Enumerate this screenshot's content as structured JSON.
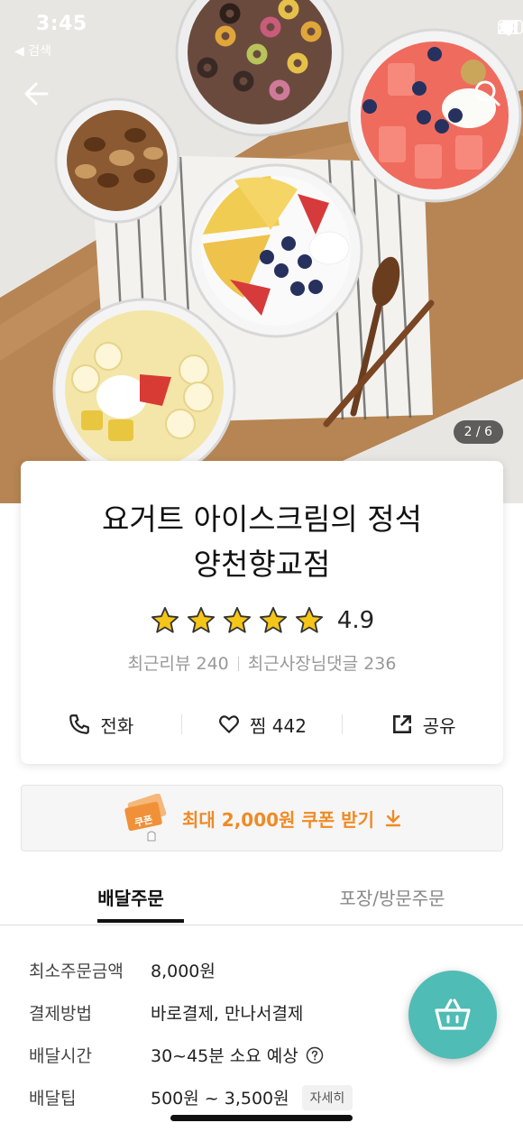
{
  "status_bar": {
    "time": "3:45",
    "back_label": "◀ 검색"
  },
  "hero": {
    "photo_counter": "2 / 6"
  },
  "store": {
    "name_line1": "요거트 아이스크림의 정석",
    "name_line2": "양천향교점",
    "rating": "4.9",
    "stars": 5,
    "recent_reviews": "최근리뷰 240",
    "owner_replies": "최근사장님댓글 236"
  },
  "actions": {
    "call_label": "전화",
    "favorite_label": "찜 442",
    "share_label": "공유"
  },
  "coupon": {
    "label": "최대 2,000원 쿠폰 받기",
    "tag_text": "쿠폰"
  },
  "tabs": [
    {
      "label": "배달주문",
      "active": true
    },
    {
      "label": "포장/방문주문",
      "active": false
    }
  ],
  "details": [
    {
      "label": "최소주문금액",
      "value": "8,000원"
    },
    {
      "label": "결제방법",
      "value": "바로결제, 만나서결제"
    },
    {
      "label": "배달시간",
      "value": "30~45분 소요 예상"
    },
    {
      "label": "배달팁",
      "value": "500원 ~ 3,500원",
      "chip": "자세히"
    }
  ],
  "colors": {
    "accent_orange": "#f08a24",
    "fab_teal": "#4fbcb5",
    "star_yellow": "#f5c518"
  },
  "icons": [
    "back-arrow-icon",
    "search-icon",
    "phone-icon",
    "heart-icon",
    "share-icon",
    "download-arrow-icon",
    "help-circle-icon",
    "basket-icon"
  ]
}
